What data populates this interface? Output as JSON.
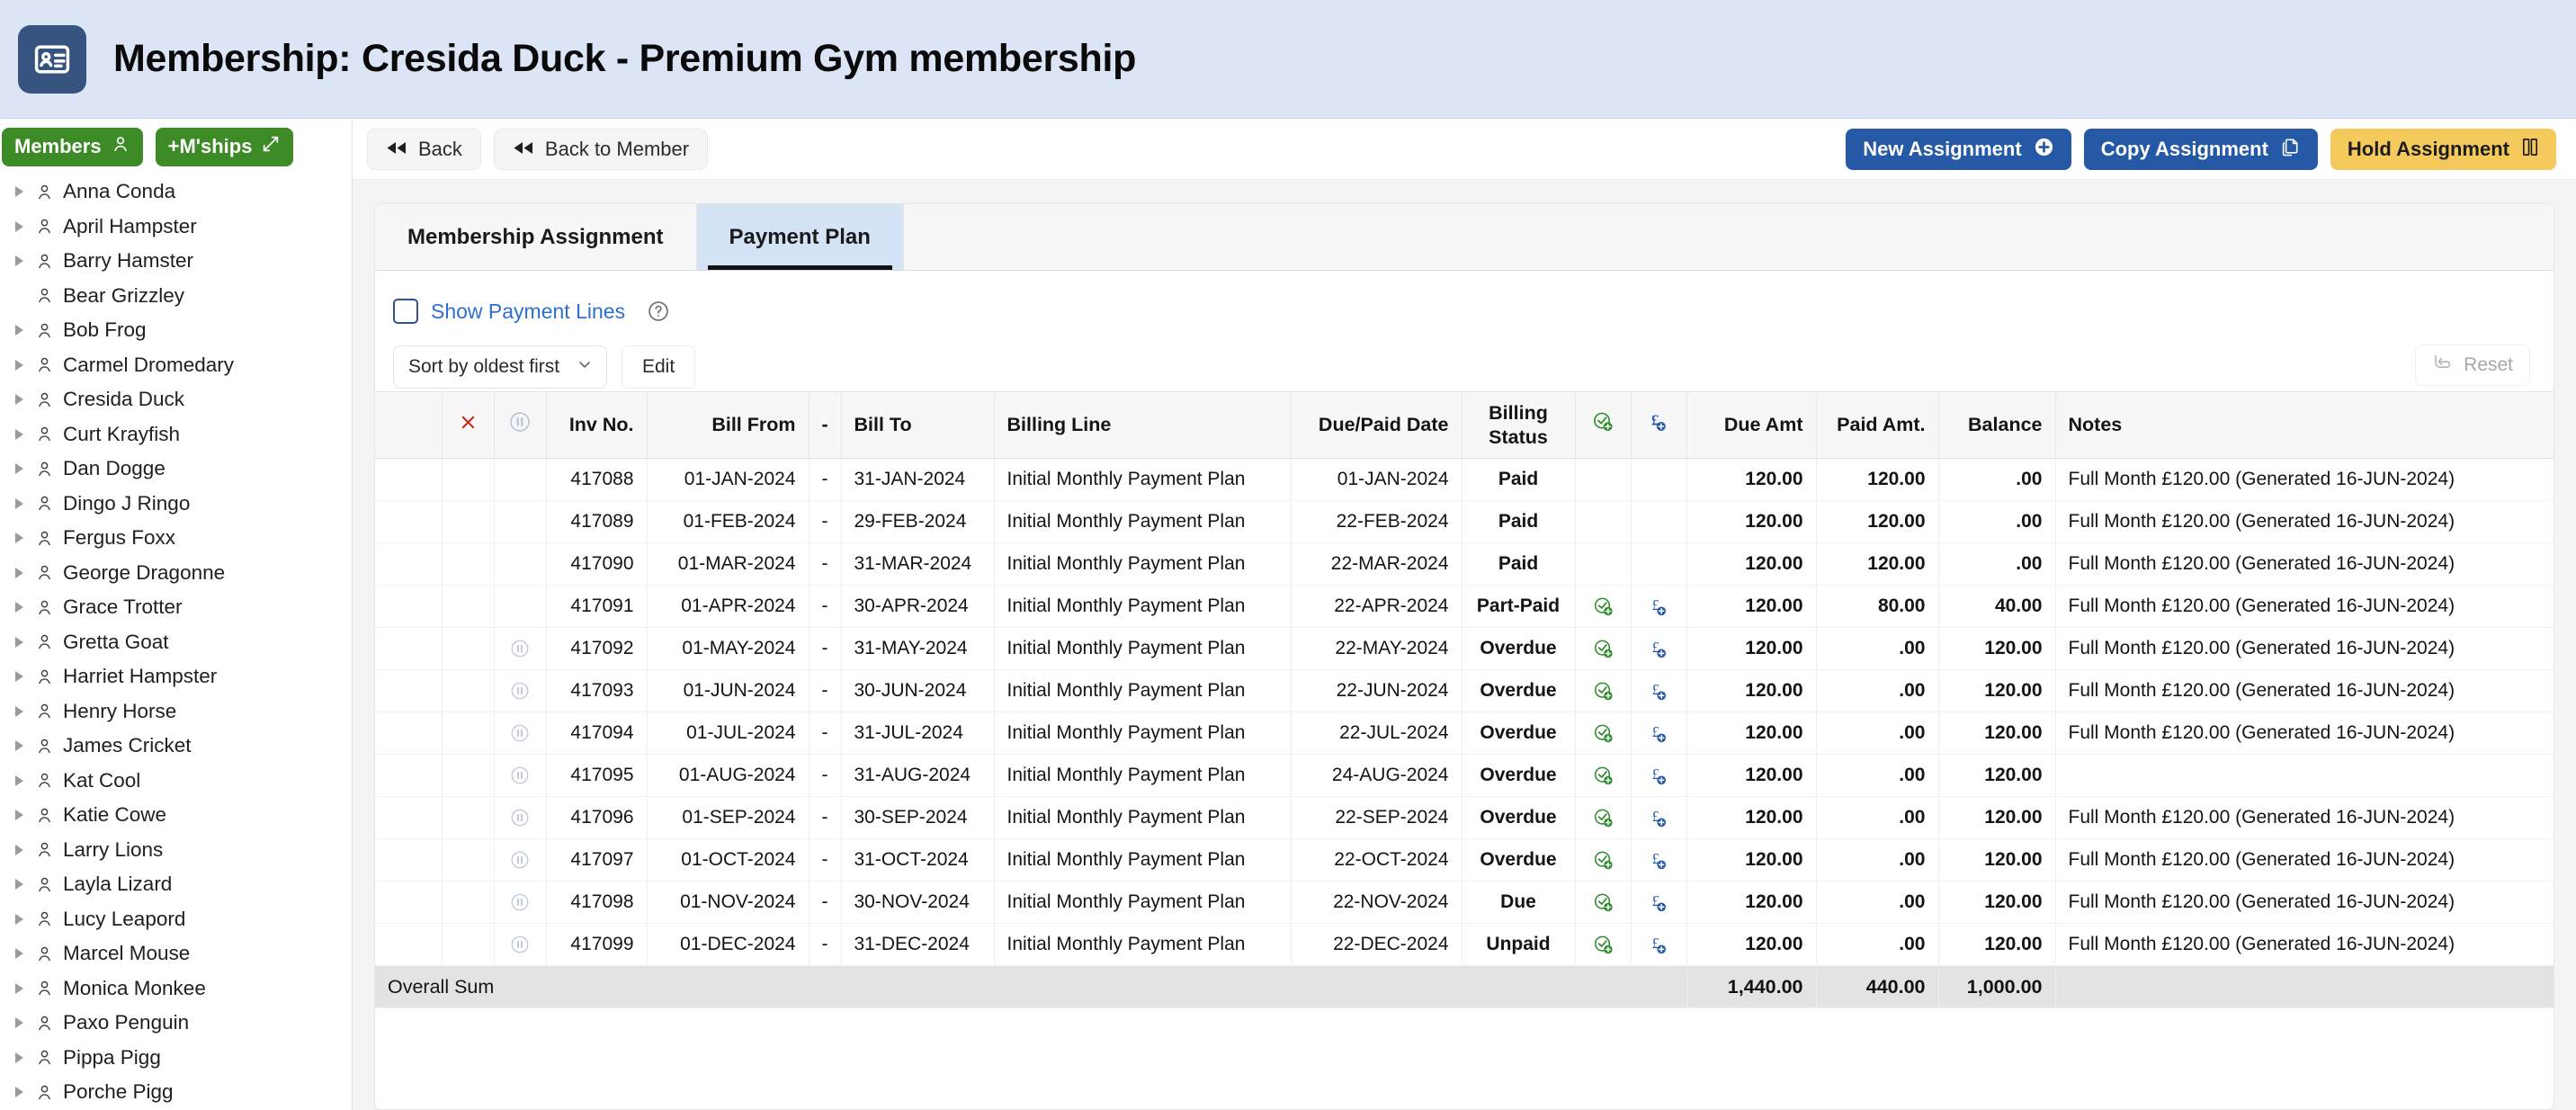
{
  "header": {
    "title": "Membership: Cresida Duck - Premium Gym membership",
    "icon": "id-card-icon",
    "bg_color": "#dbe5f5",
    "icon_box_color": "#36547f"
  },
  "sidebar": {
    "buttons": [
      {
        "label": "Members",
        "icon": "person-icon",
        "color": "#3d8b27"
      },
      {
        "label": "+M'ships",
        "icon": "expand-arrows-icon",
        "color": "#3d8b27"
      }
    ],
    "items": [
      {
        "label": "Anna Conda",
        "expandable": true
      },
      {
        "label": "April Hampster",
        "expandable": true
      },
      {
        "label": "Barry Hamster",
        "expandable": true
      },
      {
        "label": "Bear Grizzley",
        "expandable": false
      },
      {
        "label": "Bob Frog",
        "expandable": true
      },
      {
        "label": "Carmel Dromedary",
        "expandable": true
      },
      {
        "label": "Cresida Duck",
        "expandable": true
      },
      {
        "label": "Curt Krayfish",
        "expandable": true
      },
      {
        "label": "Dan Dogge",
        "expandable": true
      },
      {
        "label": "Dingo J Ringo",
        "expandable": true
      },
      {
        "label": "Fergus Foxx",
        "expandable": true
      },
      {
        "label": "George Dragonne",
        "expandable": true
      },
      {
        "label": "Grace Trotter",
        "expandable": true
      },
      {
        "label": "Gretta Goat",
        "expandable": true
      },
      {
        "label": "Harriet Hampster",
        "expandable": true
      },
      {
        "label": "Henry Horse",
        "expandable": true
      },
      {
        "label": "James Cricket",
        "expandable": true
      },
      {
        "label": "Kat Cool",
        "expandable": true
      },
      {
        "label": "Katie Cowe",
        "expandable": true
      },
      {
        "label": "Larry Lions",
        "expandable": true
      },
      {
        "label": "Layla Lizard",
        "expandable": true
      },
      {
        "label": "Lucy Leapord",
        "expandable": true
      },
      {
        "label": "Marcel Mouse",
        "expandable": true
      },
      {
        "label": "Monica Monkee",
        "expandable": true
      },
      {
        "label": "Paxo Penguin",
        "expandable": true
      },
      {
        "label": "Pippa Pigg",
        "expandable": true
      },
      {
        "label": "Porche Pigg",
        "expandable": true
      }
    ]
  },
  "toolbar": {
    "back_label": "Back",
    "back_to_member_label": "Back to Member",
    "new_assignment_label": "New Assignment",
    "copy_assignment_label": "Copy Assignment",
    "hold_assignment_label": "Hold Assignment",
    "blue_color": "#2559a5",
    "yellow_color": "#f4ca5c"
  },
  "tabs": [
    {
      "label": "Membership Assignment",
      "active": false
    },
    {
      "label": "Payment Plan",
      "active": true
    }
  ],
  "options_row": {
    "show_payment_lines_label": "Show Payment Lines",
    "show_payment_lines_checked": false,
    "help_icon": "question-circle-icon"
  },
  "controls": {
    "sort_value": "Sort by oldest first",
    "edit_label": "Edit",
    "reset_label": "Reset"
  },
  "table": {
    "columns": [
      {
        "key": "select",
        "label": ""
      },
      {
        "key": "delete",
        "label": "X"
      },
      {
        "key": "hold",
        "label": ""
      },
      {
        "key": "inv_no",
        "label": "Inv No."
      },
      {
        "key": "bill_from",
        "label": "Bill From"
      },
      {
        "key": "dash",
        "label": "-"
      },
      {
        "key": "bill_to",
        "label": "Bill To"
      },
      {
        "key": "billing_line",
        "label": "Billing Line"
      },
      {
        "key": "due_paid_date",
        "label": "Due/Paid Date"
      },
      {
        "key": "billing_status",
        "label": "Billing Status"
      },
      {
        "key": "mark_paid",
        "label": ""
      },
      {
        "key": "add_payment",
        "label": ""
      },
      {
        "key": "due_amt",
        "label": "Due Amt"
      },
      {
        "key": "paid_amt",
        "label": "Paid Amt."
      },
      {
        "key": "balance",
        "label": "Balance"
      },
      {
        "key": "notes",
        "label": "Notes"
      }
    ],
    "header_icons": {
      "delete": "red-x-icon",
      "hold": "pause-circle-icon",
      "mark_paid": "green-check-plus-icon",
      "add_payment": "pound-plus-icon"
    },
    "rows": [
      {
        "hold": false,
        "inv_no": "417088",
        "bill_from": "01-JAN-2024",
        "dash": "-",
        "bill_to": "31-JAN-2024",
        "billing_line": "Initial Monthly Payment Plan",
        "due_paid_date": "01-JAN-2024",
        "billing_status": "Paid",
        "status_color": "green",
        "actions": false,
        "due_amt": "120.00",
        "paid_amt": "120.00",
        "balance": ".00",
        "balance_color": "green",
        "notes": "Full Month £120.00 (Generated 16-JUN-2024)"
      },
      {
        "hold": false,
        "inv_no": "417089",
        "bill_from": "01-FEB-2024",
        "dash": "-",
        "bill_to": "29-FEB-2024",
        "billing_line": "Initial Monthly Payment Plan",
        "due_paid_date": "22-FEB-2024",
        "billing_status": "Paid",
        "status_color": "green",
        "actions": false,
        "due_amt": "120.00",
        "paid_amt": "120.00",
        "balance": ".00",
        "balance_color": "green",
        "notes": "Full Month £120.00 (Generated 16-JUN-2024)"
      },
      {
        "hold": false,
        "inv_no": "417090",
        "bill_from": "01-MAR-2024",
        "dash": "-",
        "bill_to": "31-MAR-2024",
        "billing_line": "Initial Monthly Payment Plan",
        "due_paid_date": "22-MAR-2024",
        "billing_status": "Paid",
        "status_color": "green",
        "actions": false,
        "due_amt": "120.00",
        "paid_amt": "120.00",
        "balance": ".00",
        "balance_color": "green",
        "notes": "Full Month £120.00 (Generated 16-JUN-2024)"
      },
      {
        "hold": false,
        "inv_no": "417091",
        "bill_from": "01-APR-2024",
        "dash": "-",
        "bill_to": "30-APR-2024",
        "billing_line": "Initial Monthly Payment Plan",
        "due_paid_date": "22-APR-2024",
        "billing_status": "Part-Paid",
        "status_color": "orange",
        "actions": true,
        "due_amt": "120.00",
        "paid_amt": "80.00",
        "balance": "40.00",
        "balance_color": "red",
        "notes": "Full Month £120.00 (Generated 16-JUN-2024)"
      },
      {
        "hold": true,
        "inv_no": "417092",
        "bill_from": "01-MAY-2024",
        "dash": "-",
        "bill_to": "31-MAY-2024",
        "billing_line": "Initial Monthly Payment Plan",
        "due_paid_date": "22-MAY-2024",
        "billing_status": "Overdue",
        "status_color": "red",
        "actions": true,
        "due_amt": "120.00",
        "paid_amt": ".00",
        "balance": "120.00",
        "balance_color": "red",
        "notes": "Full Month £120.00 (Generated 16-JUN-2024)"
      },
      {
        "hold": true,
        "inv_no": "417093",
        "bill_from": "01-JUN-2024",
        "dash": "-",
        "bill_to": "30-JUN-2024",
        "billing_line": "Initial Monthly Payment Plan",
        "due_paid_date": "22-JUN-2024",
        "billing_status": "Overdue",
        "status_color": "red",
        "actions": true,
        "due_amt": "120.00",
        "paid_amt": ".00",
        "balance": "120.00",
        "balance_color": "red",
        "notes": "Full Month £120.00 (Generated 16-JUN-2024)"
      },
      {
        "hold": true,
        "inv_no": "417094",
        "bill_from": "01-JUL-2024",
        "dash": "-",
        "bill_to": "31-JUL-2024",
        "billing_line": "Initial Monthly Payment Plan",
        "due_paid_date": "22-JUL-2024",
        "billing_status": "Overdue",
        "status_color": "red",
        "actions": true,
        "due_amt": "120.00",
        "paid_amt": ".00",
        "balance": "120.00",
        "balance_color": "red",
        "notes": "Full Month £120.00 (Generated 16-JUN-2024)"
      },
      {
        "hold": true,
        "inv_no": "417095",
        "bill_from": "01-AUG-2024",
        "dash": "-",
        "bill_to": "31-AUG-2024",
        "billing_line": "Initial Monthly Payment Plan",
        "due_paid_date": "24-AUG-2024",
        "billing_status": "Overdue",
        "status_color": "red",
        "actions": true,
        "due_amt": "120.00",
        "paid_amt": ".00",
        "balance": "120.00",
        "balance_color": "red",
        "notes": ""
      },
      {
        "hold": true,
        "inv_no": "417096",
        "bill_from": "01-SEP-2024",
        "dash": "-",
        "bill_to": "30-SEP-2024",
        "billing_line": "Initial Monthly Payment Plan",
        "due_paid_date": "22-SEP-2024",
        "billing_status": "Overdue",
        "status_color": "red",
        "actions": true,
        "due_amt": "120.00",
        "paid_amt": ".00",
        "balance": "120.00",
        "balance_color": "red",
        "notes": "Full Month £120.00 (Generated 16-JUN-2024)"
      },
      {
        "hold": true,
        "inv_no": "417097",
        "bill_from": "01-OCT-2024",
        "dash": "-",
        "bill_to": "31-OCT-2024",
        "billing_line": "Initial Monthly Payment Plan",
        "due_paid_date": "22-OCT-2024",
        "billing_status": "Overdue",
        "status_color": "red",
        "actions": true,
        "due_amt": "120.00",
        "paid_amt": ".00",
        "balance": "120.00",
        "balance_color": "red",
        "notes": "Full Month £120.00 (Generated 16-JUN-2024)"
      },
      {
        "hold": true,
        "inv_no": "417098",
        "bill_from": "01-NOV-2024",
        "dash": "-",
        "bill_to": "30-NOV-2024",
        "billing_line": "Initial Monthly Payment Plan",
        "due_paid_date": "22-NOV-2024",
        "billing_status": "Due",
        "status_color": "red",
        "actions": true,
        "due_amt": "120.00",
        "paid_amt": ".00",
        "balance": "120.00",
        "balance_color": "red",
        "notes": "Full Month £120.00 (Generated 16-JUN-2024)"
      },
      {
        "hold": true,
        "inv_no": "417099",
        "bill_from": "01-DEC-2024",
        "dash": "-",
        "bill_to": "31-DEC-2024",
        "billing_line": "Initial Monthly Payment Plan",
        "due_paid_date": "22-DEC-2024",
        "billing_status": "Unpaid",
        "status_color": "orange",
        "actions": true,
        "due_amt": "120.00",
        "paid_amt": ".00",
        "balance": "120.00",
        "balance_color": "red",
        "notes": "Full Month £120.00 (Generated 16-JUN-2024)"
      }
    ],
    "footer": {
      "label": "Overall Sum",
      "due_amt": "1,440.00",
      "paid_amt": "440.00",
      "balance": "1,000.00"
    }
  }
}
